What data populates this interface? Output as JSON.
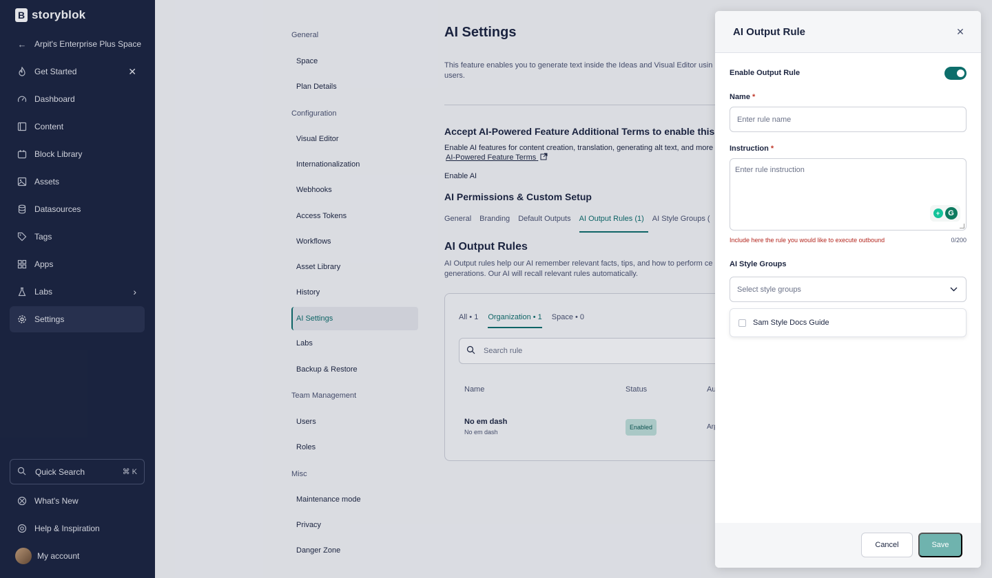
{
  "brand": {
    "logo_letter": "B",
    "name": "storyblok"
  },
  "sidebar": {
    "space_back": "Arpit's Enterprise Plus Space",
    "items": [
      {
        "label": "Get Started",
        "icon": "flame-icon"
      },
      {
        "label": "Dashboard",
        "icon": "gauge-icon"
      },
      {
        "label": "Content",
        "icon": "content-icon"
      },
      {
        "label": "Block Library",
        "icon": "block-library-icon"
      },
      {
        "label": "Assets",
        "icon": "image-icon"
      },
      {
        "label": "Datasources",
        "icon": "database-icon"
      },
      {
        "label": "Tags",
        "icon": "tag-icon"
      },
      {
        "label": "Apps",
        "icon": "grid-icon"
      },
      {
        "label": "Labs",
        "icon": "flask-icon"
      },
      {
        "label": "Settings",
        "icon": "gear-icon"
      }
    ],
    "quick_search": {
      "label": "Quick Search",
      "shortcut": "⌘ K"
    },
    "whats_new": "What's New",
    "help": "Help & Inspiration",
    "account": "My account"
  },
  "settings_nav": {
    "general_head": "General",
    "space": "Space",
    "plan_details": "Plan Details",
    "configuration_head": "Configuration",
    "visual_editor": "Visual Editor",
    "internationalization": "Internationalization",
    "webhooks": "Webhooks",
    "access_tokens": "Access Tokens",
    "workflows": "Workflows",
    "asset_library": "Asset Library",
    "history": "History",
    "ai_settings": "AI Settings",
    "labs": "Labs",
    "backup_restore": "Backup & Restore",
    "team_head": "Team Management",
    "users": "Users",
    "roles": "Roles",
    "misc_head": "Misc",
    "maintenance": "Maintenance mode",
    "privacy": "Privacy",
    "danger_zone": "Danger Zone"
  },
  "main": {
    "title": "AI Settings",
    "desc": "This feature enables you to generate text inside the Ideas and Visual Editor usin users.",
    "terms_heading": "Accept AI-Powered Feature Additional Terms to enable this fe",
    "terms_text": "Enable AI features for content creation, translation, generating alt text, and more",
    "terms_link": "AI-Powered Feature Terms",
    "enable_ai": "Enable AI",
    "perm_heading": "AI Permissions & Custom Setup",
    "tabs": [
      "General",
      "Branding",
      "Default Outputs",
      "AI Output Rules (1)",
      "AI Style Groups ("
    ],
    "rules_heading": "AI Output Rules",
    "rules_desc": "AI Output rules help our AI remember relevant facts, tips, and how to perform ce generations. Our AI will recall relevant rules automatically.",
    "card": {
      "tabs": [
        "All • 1",
        "Organization • 1",
        "Space • 0"
      ],
      "search_placeholder": "Search rule",
      "col_name": "Name",
      "col_status": "Status",
      "col_author": "Au",
      "row": {
        "name": "No em dash",
        "sub": "No em dash",
        "status": "Enabled",
        "author": "Arp"
      }
    }
  },
  "panel": {
    "title": "AI Output Rule",
    "enable_label": "Enable Output Rule",
    "enabled": true,
    "name_label": "Name",
    "name_placeholder": "Enter rule name",
    "instruction_label": "Instruction",
    "instruction_placeholder": "Enter rule instruction",
    "required_mark": "*",
    "hint": "Include here the rule you would like to execute outbound",
    "counter": "0/200",
    "style_groups_label": "AI Style Groups",
    "style_groups_placeholder": "Select style groups",
    "option": "Sam Style Docs Guide",
    "cancel": "Cancel",
    "save": "Save"
  },
  "colors": {
    "sidebar_bg": "#1b243f",
    "accent": "#0d6e6b",
    "save_disabled": "#6fb3ae",
    "error": "#b3261e"
  }
}
